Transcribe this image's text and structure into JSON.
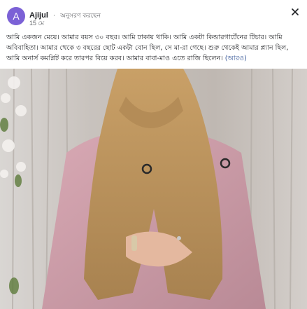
{
  "post": {
    "avatar_letter": "A",
    "author": "Ajijul",
    "separator": "·",
    "follow_label": "অনুসরণ করছেন",
    "date": "15 মে",
    "body_text": "আমি একজন মেয়ে। আমার বয়স ৩০ বছর। আমি ঢাকায় থাকি। আমি একটা কিন্ডারগার্টেনের টিচার। আমি অবিবাহিতা। আমার থেকে ৩ বছরের ছোট একটা বোন ছিল, সে মা-রা গেছে। শুরু থেকেই আমার প্ল্যান ছিল, আমি অনার্স কমপ্লিট করে তারপর বিয়ে করব। আমার বাবা-মাও এতে রাজি ছিলেন।",
    "more_label": "(আরও)"
  },
  "icons": {
    "close": "close-icon"
  },
  "colors": {
    "avatar": "#7b61d6",
    "link": "#385898",
    "text": "#1c1e21",
    "muted": "#65676b"
  },
  "photo": {
    "description_icon": "photo-image"
  }
}
